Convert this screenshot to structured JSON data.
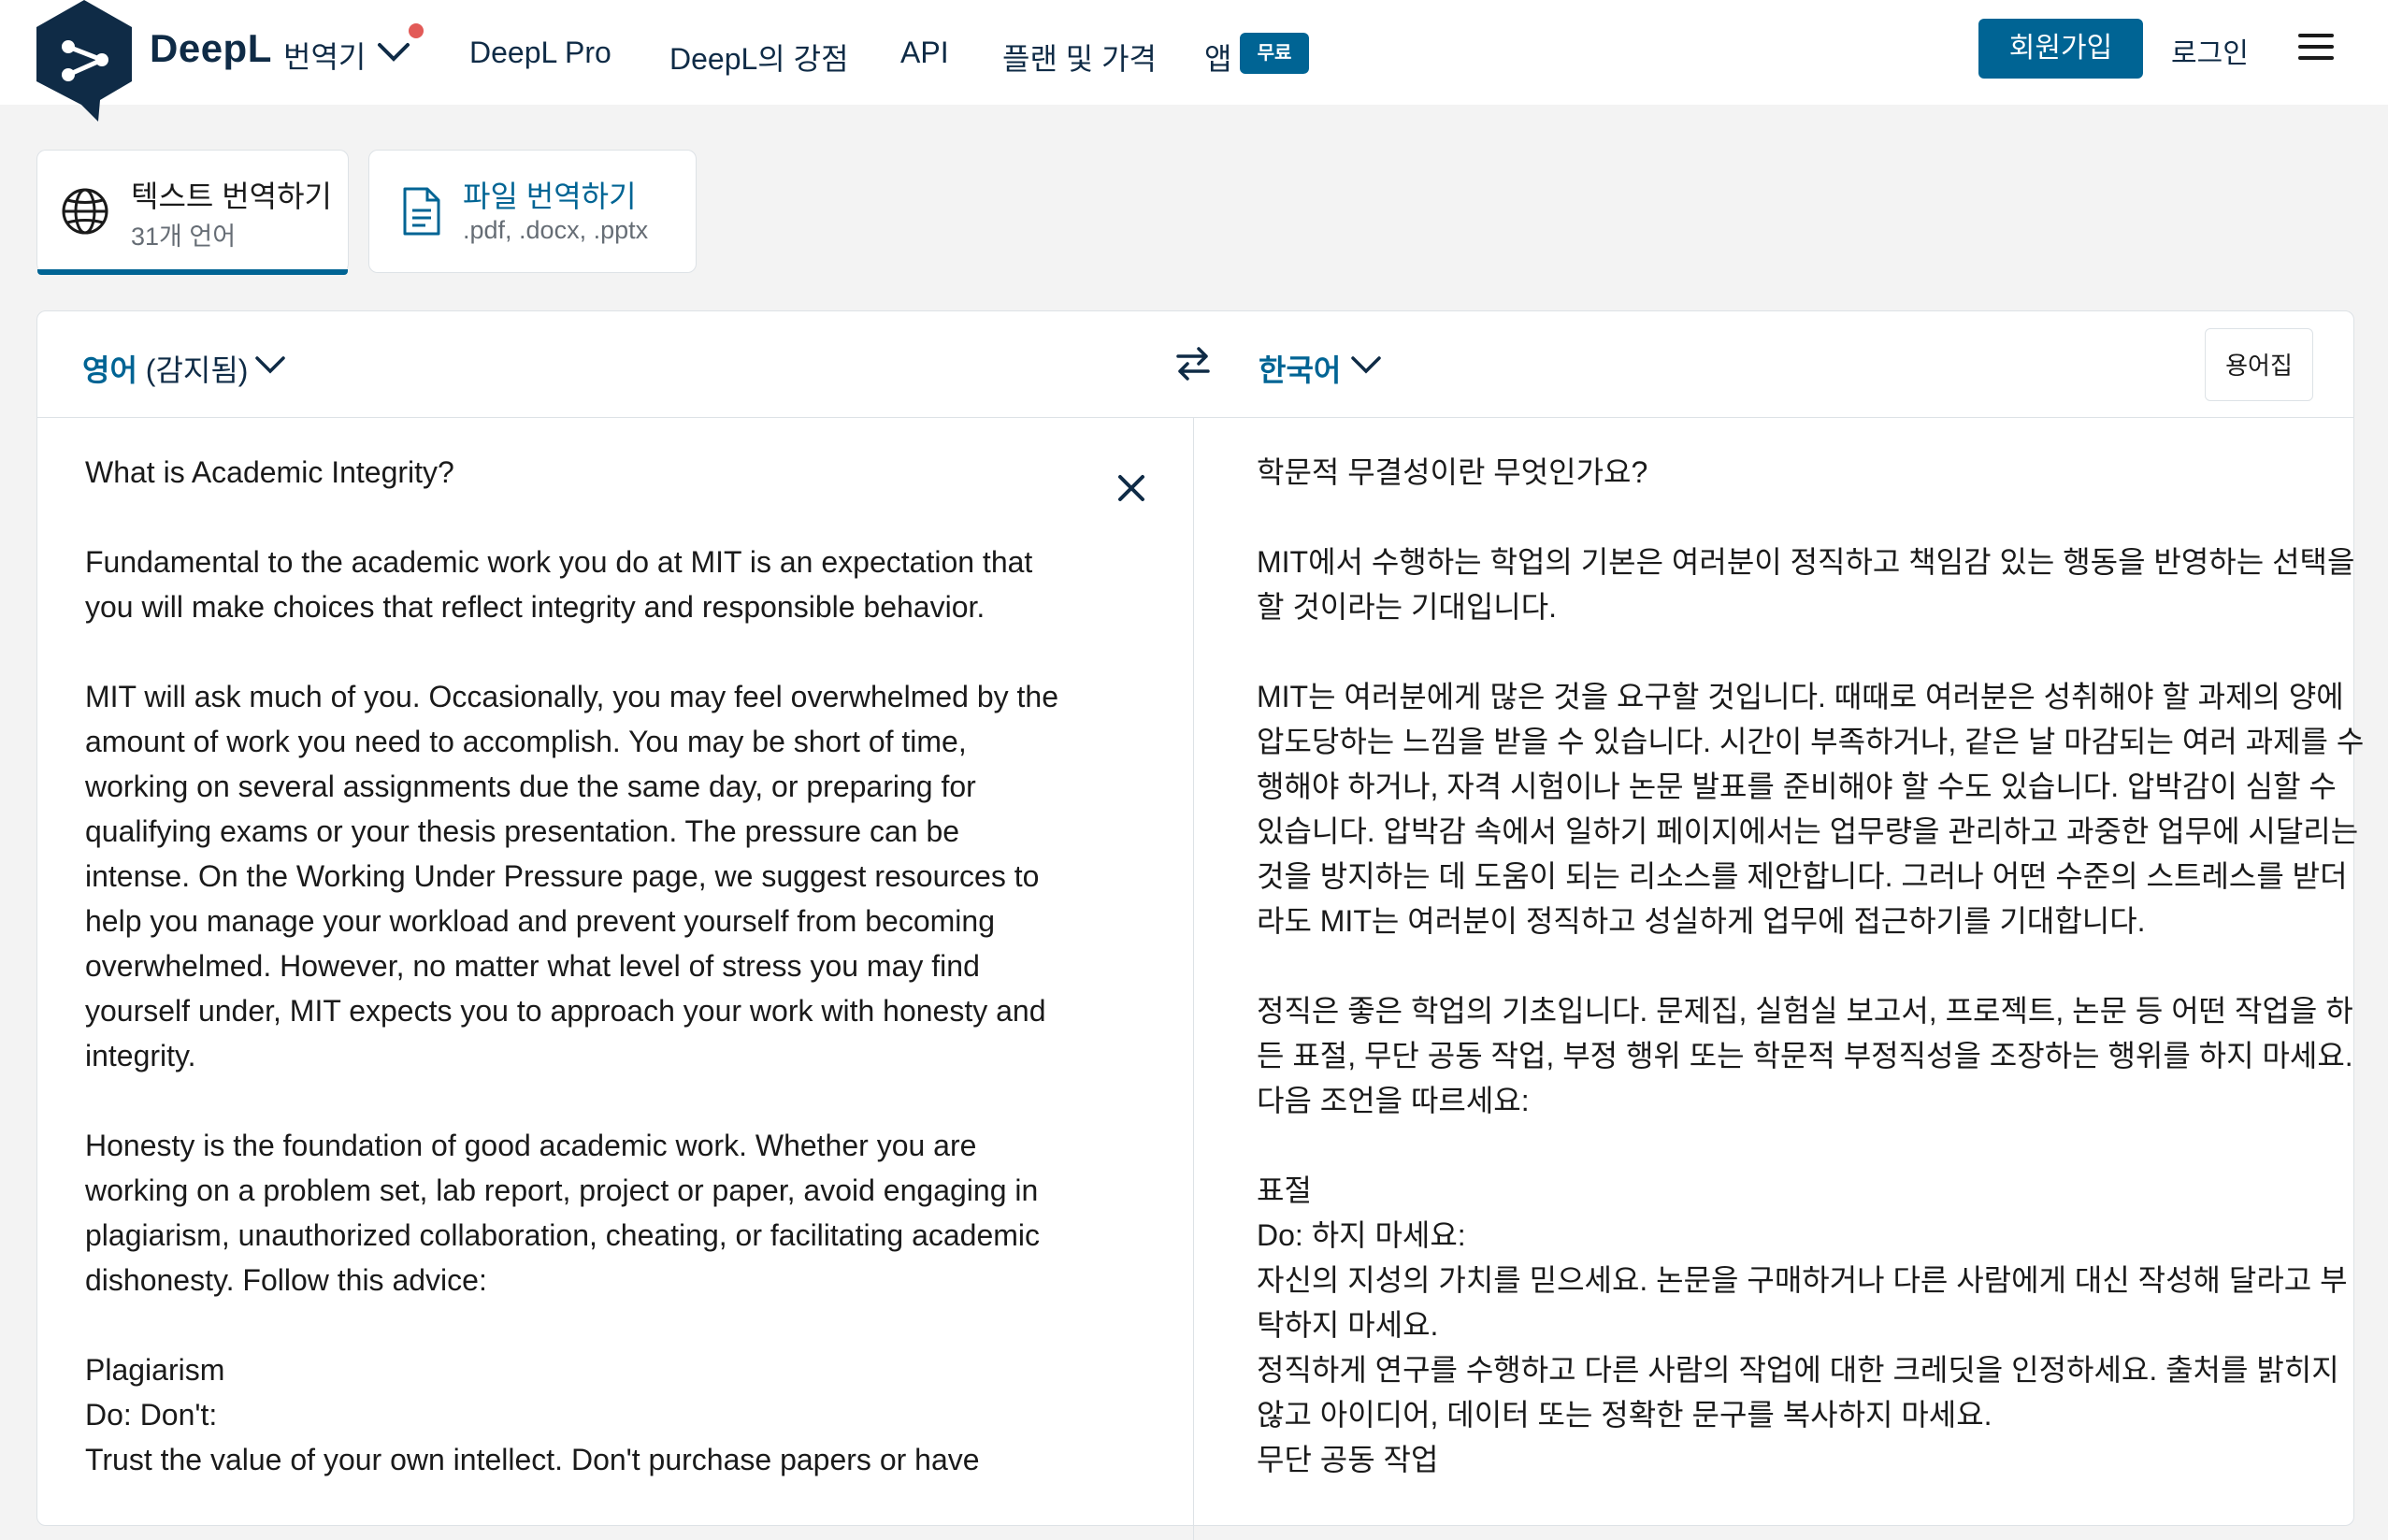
{
  "nav": {
    "brand": "DeepL",
    "brand_sub": "번역기",
    "links": [
      "DeepL Pro",
      "DeepL의 강점",
      "API",
      "플랜 및 가격",
      "앱"
    ],
    "free_badge": "무료",
    "signup": "회원가입",
    "login": "로그인",
    "colors": {
      "brand_navy": "#0f2b46",
      "accent": "#006494",
      "notify_dot": "#e25a57"
    }
  },
  "tabs": [
    {
      "title": "텍스트 번역하기",
      "subtitle": "31개 언어",
      "icon": "globe-icon",
      "active": true
    },
    {
      "title": "파일 번역하기",
      "subtitle": ".pdf, .docx, .pptx",
      "icon": "document-icon",
      "active": false
    }
  ],
  "translator": {
    "source_lang": "영어",
    "source_detected": "(감지됨)",
    "target_lang": "한국어",
    "glossary": "용어집",
    "source_paragraphs": [
      [
        "What is Academic Integrity?"
      ],
      [
        "Fundamental to the academic work you do at MIT is an expectation that",
        "you will make choices that reflect integrity and responsible behavior."
      ],
      [
        "MIT will ask much of you. Occasionally, you may feel overwhelmed by the",
        "amount of work you need to accomplish. You may be short of time,",
        "working on several assignments due the same day, or preparing for",
        "qualifying exams or your thesis presentation. The pressure can be",
        "intense. On the Working Under Pressure page, we suggest resources to",
        "help you manage your workload and prevent yourself from becoming",
        "overwhelmed. However, no matter what level of stress you may find",
        "yourself under, MIT expects you to approach your work with honesty and",
        "integrity."
      ],
      [
        "Honesty is the foundation of good academic work. Whether you are",
        "working on a problem set, lab report, project or paper, avoid engaging in",
        "plagiarism, unauthorized collaboration, cheating, or facilitating academic",
        "dishonesty. Follow this advice:"
      ],
      [
        "Plagiarism",
        "Do:  Don't:",
        "Trust the value of your own intellect.  Don't purchase papers or have"
      ]
    ],
    "target_paragraphs": [
      [
        "학문적 무결성이란 무엇인가요?"
      ],
      [
        "MIT에서 수행하는 학업의 기본은 여러분이 정직하고 책임감 있는 행동을 반영하는 선택을",
        "할 것이라는 기대입니다."
      ],
      [
        "MIT는 여러분에게 많은 것을 요구할 것입니다. 때때로 여러분은 성취해야 할 과제의 양에",
        "압도당하는 느낌을 받을 수 있습니다. 시간이 부족하거나, 같은 날 마감되는 여러 과제를 수",
        "행해야 하거나, 자격 시험이나 논문 발표를 준비해야 할 수도 있습니다. 압박감이 심할 수",
        "있습니다. 압박감 속에서 일하기 페이지에서는 업무량을 관리하고 과중한 업무에 시달리는",
        "것을 방지하는 데 도움이 되는 리소스를 제안합니다. 그러나 어떤 수준의 스트레스를 받더",
        "라도 MIT는 여러분이 정직하고 성실하게 업무에 접근하기를 기대합니다."
      ],
      [
        "정직은 좋은 학업의 기초입니다. 문제집, 실험실 보고서, 프로젝트, 논문 등 어떤 작업을 하",
        "든 표절, 무단 공동 작업, 부정 행위 또는 학문적 부정직성을 조장하는 행위를 하지 마세요.",
        "다음 조언을 따르세요:"
      ],
      [
        "표절",
        "Do:  하지 마세요:",
        "자신의 지성의 가치를 믿으세요. 논문을 구매하거나 다른 사람에게 대신 작성해 달라고 부",
        "탁하지 마세요.",
        "정직하게 연구를 수행하고 다른 사람의 작업에 대한 크레딧을 인정하세요.    출처를 밝히지",
        "않고 아이디어, 데이터 또는 정확한 문구를 복사하지 마세요.",
        "무단 공동 작업"
      ]
    ]
  }
}
